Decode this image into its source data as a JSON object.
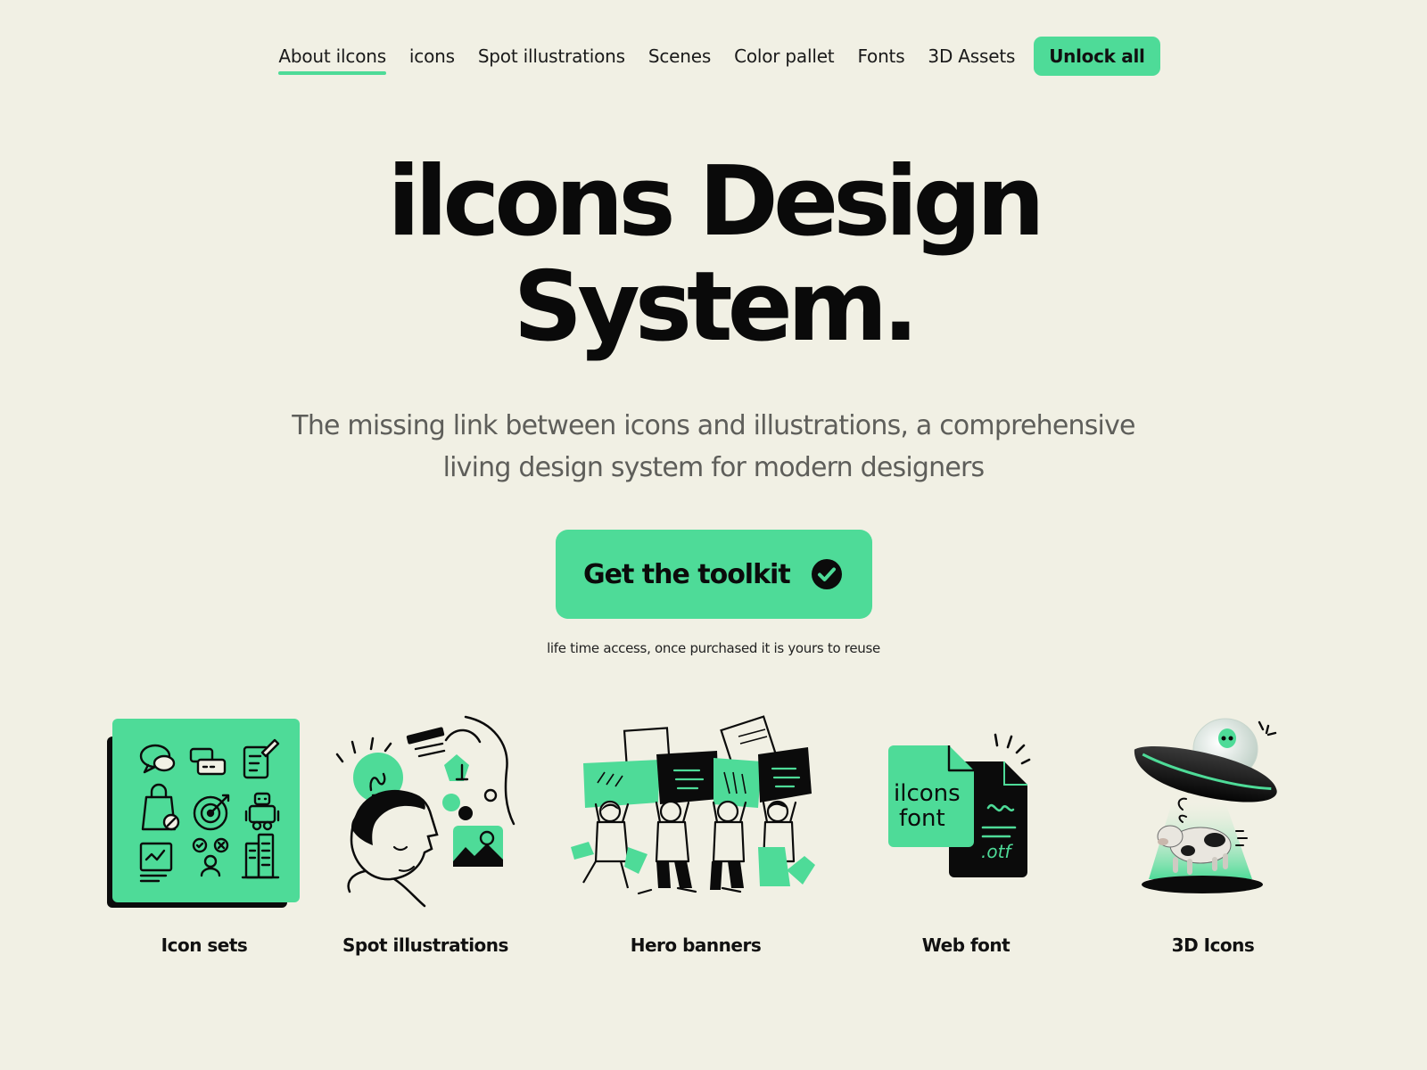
{
  "nav": {
    "items": [
      {
        "label": "About ilcons",
        "active": true
      },
      {
        "label": "icons",
        "active": false
      },
      {
        "label": "Spot illustrations",
        "active": false
      },
      {
        "label": "Scenes",
        "active": false
      },
      {
        "label": "Color pallet",
        "active": false
      },
      {
        "label": "Fonts",
        "active": false
      },
      {
        "label": "3D Assets",
        "active": false
      }
    ],
    "cta_label": "Unlock all"
  },
  "hero": {
    "title_line1": "ilcons Design",
    "title_line2": "System.",
    "subtitle_line1": "The missing link between icons and illustrations, a comprehensive",
    "subtitle_line2": "living design system for modern designers",
    "cta_label": "Get the toolkit",
    "cta_icon": "check-circle-icon",
    "note": "life time access, once purchased it is yours to reuse"
  },
  "features": [
    {
      "label": "Icon sets",
      "icon": "icon-sets-illustration"
    },
    {
      "label": "Spot illustrations",
      "icon": "spot-illustration"
    },
    {
      "label": "Hero banners",
      "icon": "hero-banner-illustration"
    },
    {
      "label": "Web font",
      "icon": "web-font-illustration",
      "card_text_1": "ilcons",
      "card_text_2": "font",
      "file_ext": ".otf"
    },
    {
      "label": "3D Icons",
      "icon": "ufo-3d-illustration"
    }
  ],
  "colors": {
    "background": "#f1f0e4",
    "accent": "#4edb98",
    "text": "#111111",
    "subtitle": "#5e5e5a"
  }
}
